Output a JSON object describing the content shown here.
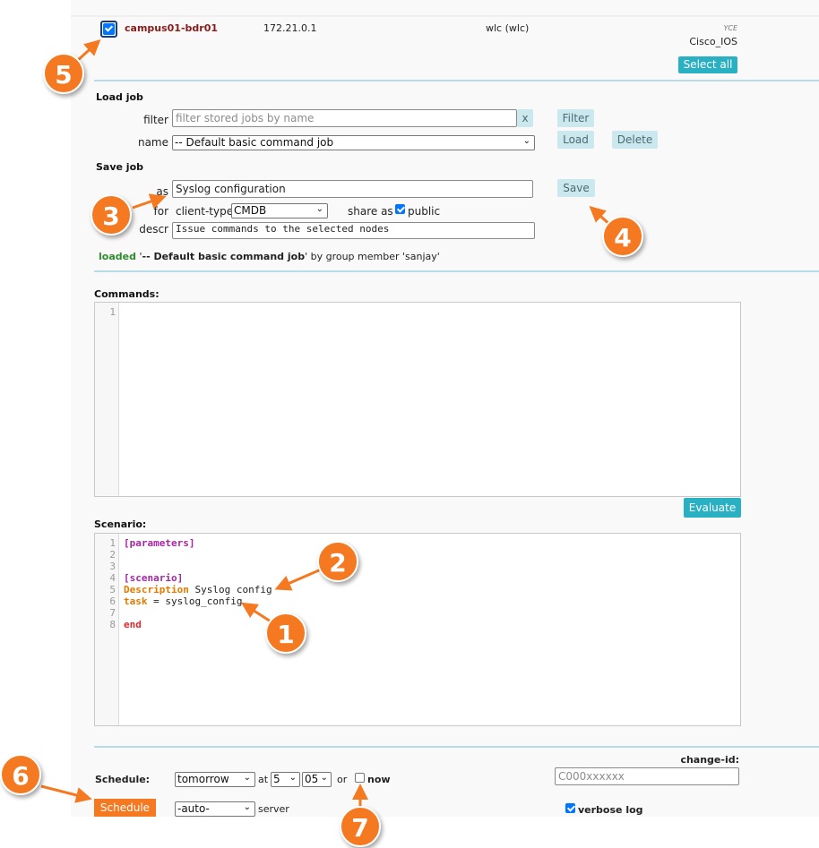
{
  "device": {
    "hostname": "campus01-bdr01",
    "ip": "172.21.0.1",
    "model": "wlc (wlc)",
    "vendor_tag": "YCE",
    "os": "Cisco_IOS",
    "selected": true
  },
  "select_all_label": "Select all",
  "load_job": {
    "title": "Load job",
    "filter_label": "filter",
    "filter_placeholder": "filter stored jobs by name",
    "clear_label": "x",
    "filter_button": "Filter",
    "name_label": "name",
    "name_value": "-- Default basic command job",
    "load_button": "Load",
    "delete_button": "Delete"
  },
  "save_job": {
    "title": "Save job",
    "as_label": "as",
    "as_value": "Syslog configuration",
    "save_button": "Save",
    "for_label": "for",
    "client_type_label": "client-type",
    "client_type_value": "CMDB",
    "share_as_label": "share as",
    "public_label": "public",
    "public_checked": true,
    "descr_label": "descr",
    "descr_value": "Issue commands to the selected nodes"
  },
  "status": {
    "loaded_word": "loaded",
    "quote_open": " '",
    "job_name": "-- Default basic command job",
    "suffix": "' by group member 'sanjay'"
  },
  "commands": {
    "title": "Commands:",
    "lines": [
      "1"
    ],
    "evaluate_button": "Evaluate"
  },
  "scenario": {
    "title": "Scenario:",
    "line_numbers": [
      "1",
      "2",
      "3",
      "4",
      "5",
      "6",
      "7",
      "8"
    ],
    "l1": "[parameters]",
    "l4": "[scenario]",
    "l5_kw": "Description",
    "l5_rest": " Syslog config",
    "l6_kw": "task",
    "l6_rest": " = syslog_config",
    "l8": "end"
  },
  "schedule": {
    "label": "Schedule:",
    "day_value": "tomorrow",
    "at_label": "at",
    "hour_value": "5",
    "minute_value": "05",
    "or_label": "or",
    "now_label": "now",
    "now_checked": false,
    "schedule_button": "Schedule",
    "server_value": "-auto-",
    "server_label": "server",
    "change_id_label": "change-id:",
    "change_id_placeholder": "C000xxxxxx",
    "verbose_label": "verbose log",
    "verbose_checked": true
  },
  "markers": [
    "1",
    "2",
    "3",
    "4",
    "5",
    "6",
    "7"
  ],
  "colors": {
    "accent_orange": "#f47920",
    "teal_button": "#2ab0c3",
    "light_button": "#cce8ef",
    "hostname": "#8b1a1a",
    "loaded": "#2e8b2e",
    "divider": "#b6dde7"
  }
}
